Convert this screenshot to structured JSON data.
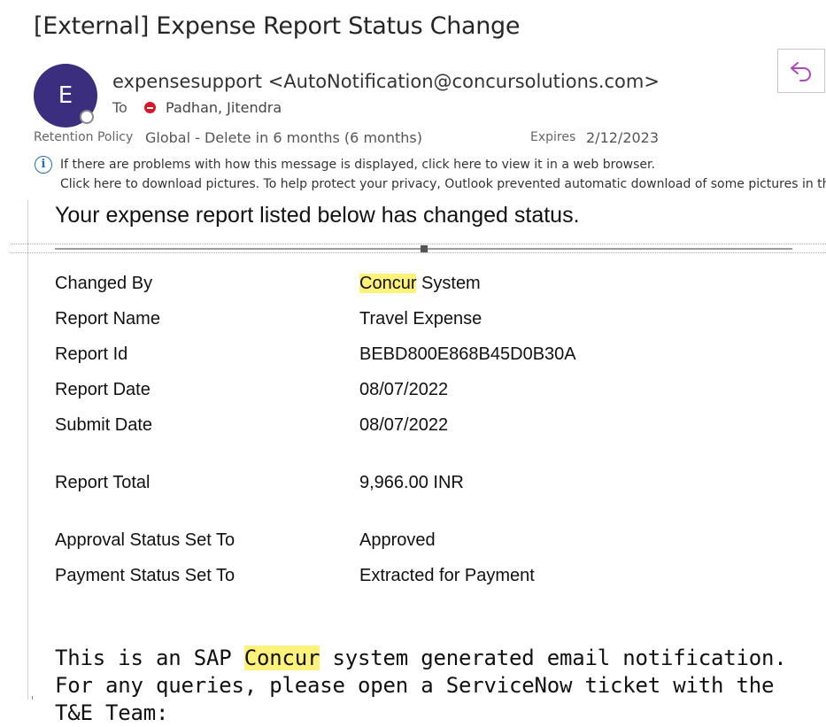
{
  "email": {
    "subject": "[External] Expense Report Status Change",
    "sender_initial": "E",
    "sender": "expensesupport <AutoNotification@concursolutions.com>",
    "to_label": "To",
    "recipient": "Padhan, Jitendra",
    "retention_label": "Retention Policy",
    "retention_value": "Global - Delete in 6 months (6 months)",
    "expires_label": "Expires",
    "expires_value": "2/12/2023",
    "info_line_1": "If there are problems with how this message is displayed, click here to view it in a web browser.",
    "info_line_2": "Click here to download pictures. To help protect your privacy, Outlook prevented automatic download of some pictures in this message."
  },
  "body": {
    "headline": "Your expense report listed below has changed status.",
    "highlight_term": "Concur",
    "rows": [
      {
        "label": "Changed By",
        "value_prefix": "Concur",
        "value": " System"
      },
      {
        "label": "Report Name",
        "value": "Travel Expense"
      },
      {
        "label": "Report Id",
        "value": "BEBD800E868B45D0B30A"
      },
      {
        "label": "Report Date",
        "value": "08/07/2022"
      },
      {
        "label": "Submit Date",
        "value": "08/07/2022"
      },
      {
        "label": "Report Total",
        "value": "9,966.00 INR"
      },
      {
        "label": "Approval Status Set To",
        "value": "Approved"
      },
      {
        "label": "Payment Status Set To",
        "value": "Extracted for Payment"
      }
    ],
    "footer_pre": "This is an SAP ",
    "footer_highlight": "Concur",
    "footer_post": " system generated email notification. For any queries, please open a ServiceNow ticket with the T&E Team:"
  },
  "colors": {
    "avatar": "#3b2e7e",
    "highlight": "#fff27a",
    "reply_icon": "#b146c2",
    "info_icon": "#1f6fb5",
    "busy_status": "#d7182a"
  },
  "icons": {
    "reply": "reply-arrow-icon",
    "info": "info-circle-icon",
    "presence": "presence-offline-icon",
    "busy": "do-not-disturb-icon"
  }
}
